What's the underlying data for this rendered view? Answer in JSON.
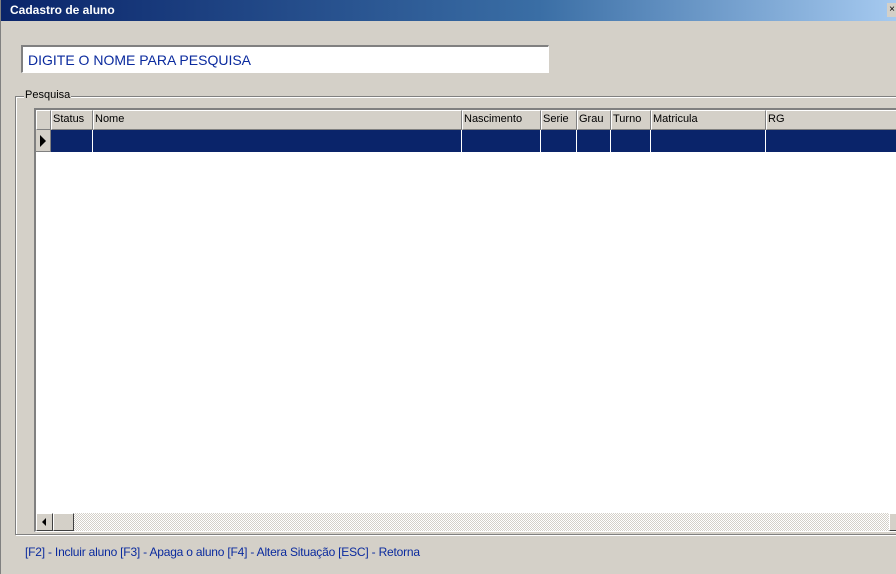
{
  "window": {
    "title": "Cadastro de aluno",
    "close_label": "×"
  },
  "search": {
    "value": "DIGITE O NOME PARA PESQUISA"
  },
  "groupbox": {
    "label": "Pesquisa"
  },
  "grid": {
    "columns": [
      "",
      "Status",
      "Nome",
      "Nascimento",
      "Serie",
      "Grau",
      "Turno",
      "Matricula",
      "RG"
    ],
    "rows": [
      [
        "",
        "",
        "",
        "",
        "",
        "",
        "",
        ""
      ]
    ]
  },
  "footer": {
    "shortcuts": "[F2] - Incluir aluno  [F3] - Apaga o aluno  [F4] - Altera Situação  [ESC] - Retorna"
  },
  "colors": {
    "title_bar": "#0a246a",
    "selected_row": "#0a246a",
    "accent_text": "#0a2a9e",
    "window_bg": "#d4d0c8"
  }
}
